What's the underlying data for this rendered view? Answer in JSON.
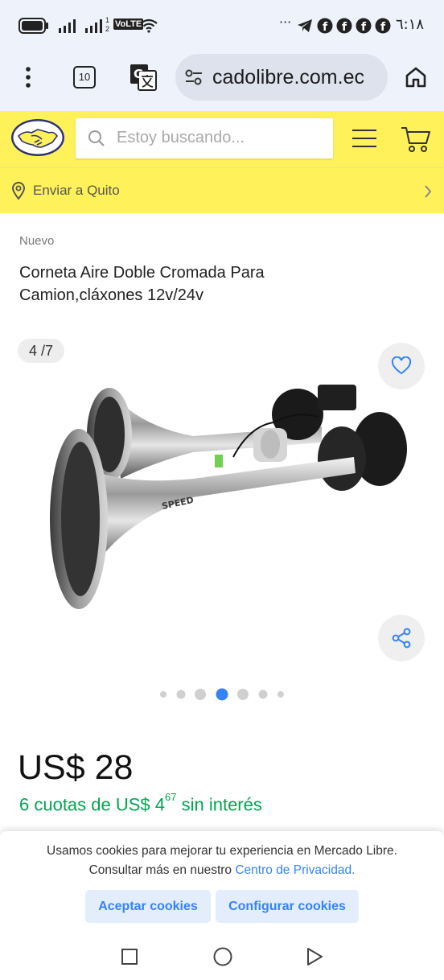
{
  "status_bar": {
    "network_left": "VoLTE",
    "sim_label": "1",
    "sim_label_2": "2",
    "time": "٦:١٨",
    "more": "···"
  },
  "browser": {
    "tab_count": "10",
    "url": "cadolibre.com.ec"
  },
  "header": {
    "search_placeholder": "Estoy buscando..."
  },
  "location": {
    "text": "Enviar a Quito"
  },
  "product": {
    "condition": "Nuevo",
    "title": "Corneta Aire Doble Cromada Para Camion,cláxones 12v/24v",
    "image_counter": "4 /7",
    "image_brand_text": "SPEED",
    "current_image_index": 4,
    "total_images": 7,
    "price": "US$ 28",
    "installments_prefix": "6 cuotas de US$ 4",
    "installments_cents": "67",
    "installments_suffix": " sin interés"
  },
  "cookie_banner": {
    "text": "Usamos cookies para mejorar tu experiencia en Mercado Libre. Consultar más en nuestro ",
    "link": "Centro de Privacidad.",
    "accept_label": "Aceptar cookies",
    "configure_label": "Configurar cookies"
  },
  "colors": {
    "brand_yellow": "#fff159",
    "accent_blue": "#3483fa",
    "installment_green": "#00a650"
  }
}
